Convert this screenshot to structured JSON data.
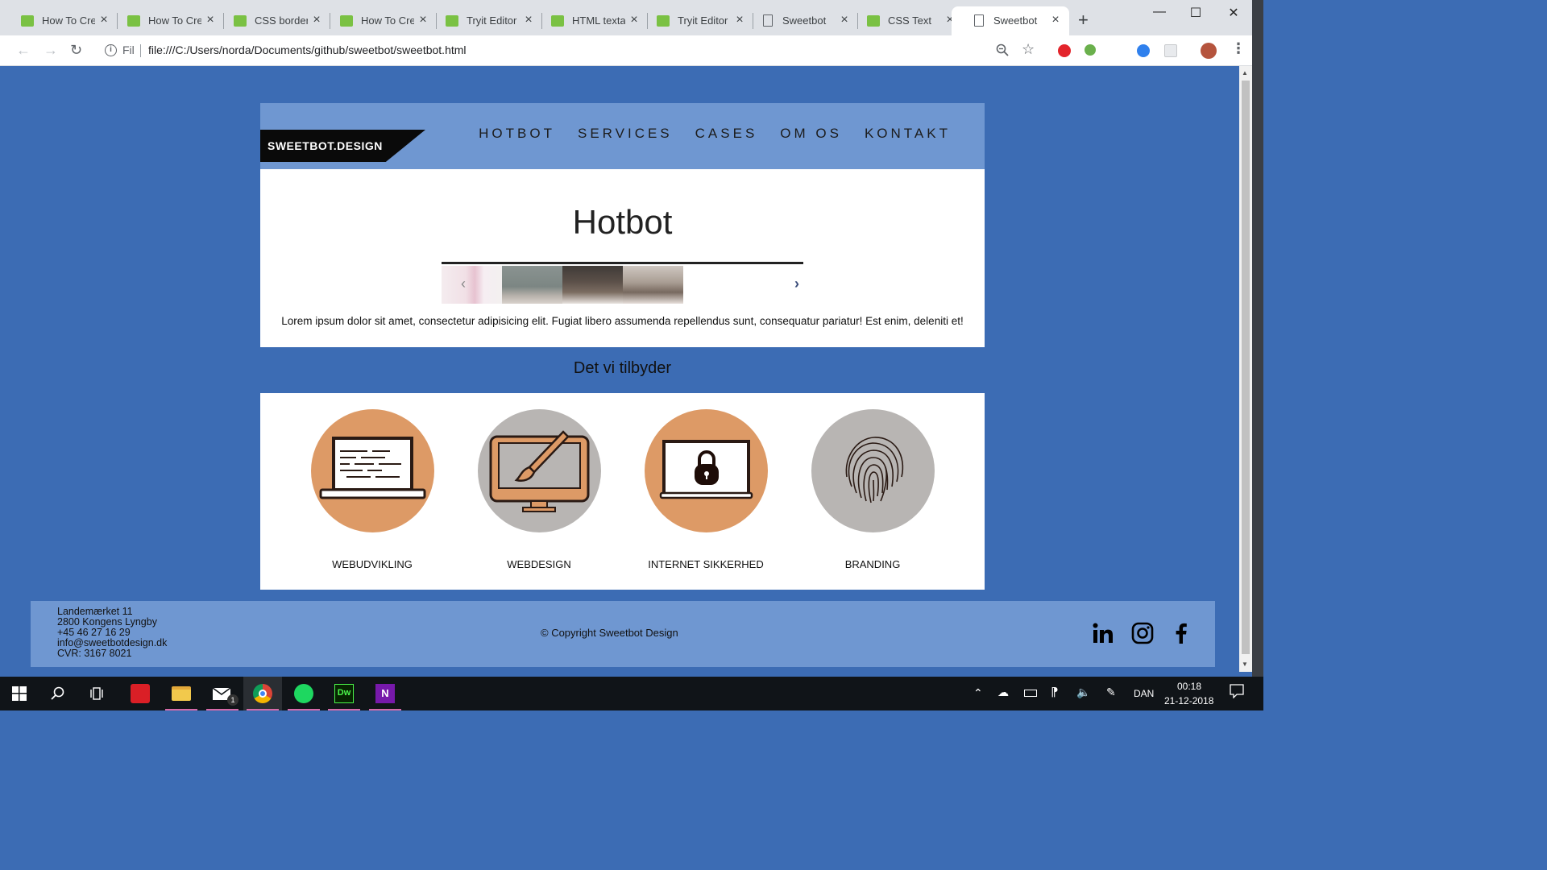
{
  "browser": {
    "tabs": [
      {
        "title": "How To Crea",
        "icon": "w3-favicon"
      },
      {
        "title": "How To Crea",
        "icon": "w3-favicon"
      },
      {
        "title": "CSS border-",
        "icon": "w3-favicon"
      },
      {
        "title": "How To Crea",
        "icon": "w3-favicon"
      },
      {
        "title": "Tryit Editor v",
        "icon": "w3-favicon"
      },
      {
        "title": "HTML textar",
        "icon": "w3-favicon"
      },
      {
        "title": "Tryit Editor v",
        "icon": "w3-favicon"
      },
      {
        "title": "Sweetbot",
        "icon": "document-icon"
      },
      {
        "title": "CSS Text",
        "icon": "w3-favicon"
      },
      {
        "title": "Sweetbot",
        "icon": "document-icon"
      }
    ],
    "active_tab_index": 9,
    "scheme_label": "Fil",
    "url": "file:///C:/Users/norda/Documents/github/sweetbot/sweetbot.html"
  },
  "site": {
    "logo": "SWEETBOT.DESIGN",
    "nav": [
      "HOTBOT",
      "SERVICES",
      "CASES",
      "OM OS",
      "KONTAKT"
    ],
    "hero_title": "Hotbot",
    "hero_text": "Lorem ipsum dolor sit amet, consectetur adipisicing elit. Fugiat libero assumenda repellendus sunt, consequatur pariatur! Est enim, deleniti et!",
    "offer_title": "Det vi tilbyder",
    "services": [
      {
        "label": "WEBUDVIKLING",
        "icon": "laptop-code-icon",
        "color": "#dd9a66"
      },
      {
        "label": "WEBDESIGN",
        "icon": "monitor-brush-icon",
        "color": "#b8b5b3"
      },
      {
        "label": "INTERNET SIKKERHED",
        "icon": "laptop-lock-icon",
        "color": "#dd9a66"
      },
      {
        "label": "BRANDING",
        "icon": "fingerprint-icon",
        "color": "#b8b5b3"
      }
    ],
    "footer": {
      "address": [
        "Landemærket 11",
        "2800 Kongens Lyngby",
        "+45 46 27 16 29",
        "info@sweetbotdesign.dk",
        "CVR: 3167 8021"
      ],
      "copyright": "© Copyright Sweetbot Design",
      "social": [
        "linkedin-icon",
        "instagram-icon",
        "facebook-icon"
      ]
    },
    "colors": {
      "page_bg": "#3c6cb4",
      "header_bg": "#6f97d1",
      "accent_orange": "#dd9a66",
      "accent_grey": "#b8b5b3"
    }
  },
  "taskbar": {
    "time": "00:18",
    "date": "21-12-2018",
    "language": "DAN",
    "mail_badge": "1"
  }
}
